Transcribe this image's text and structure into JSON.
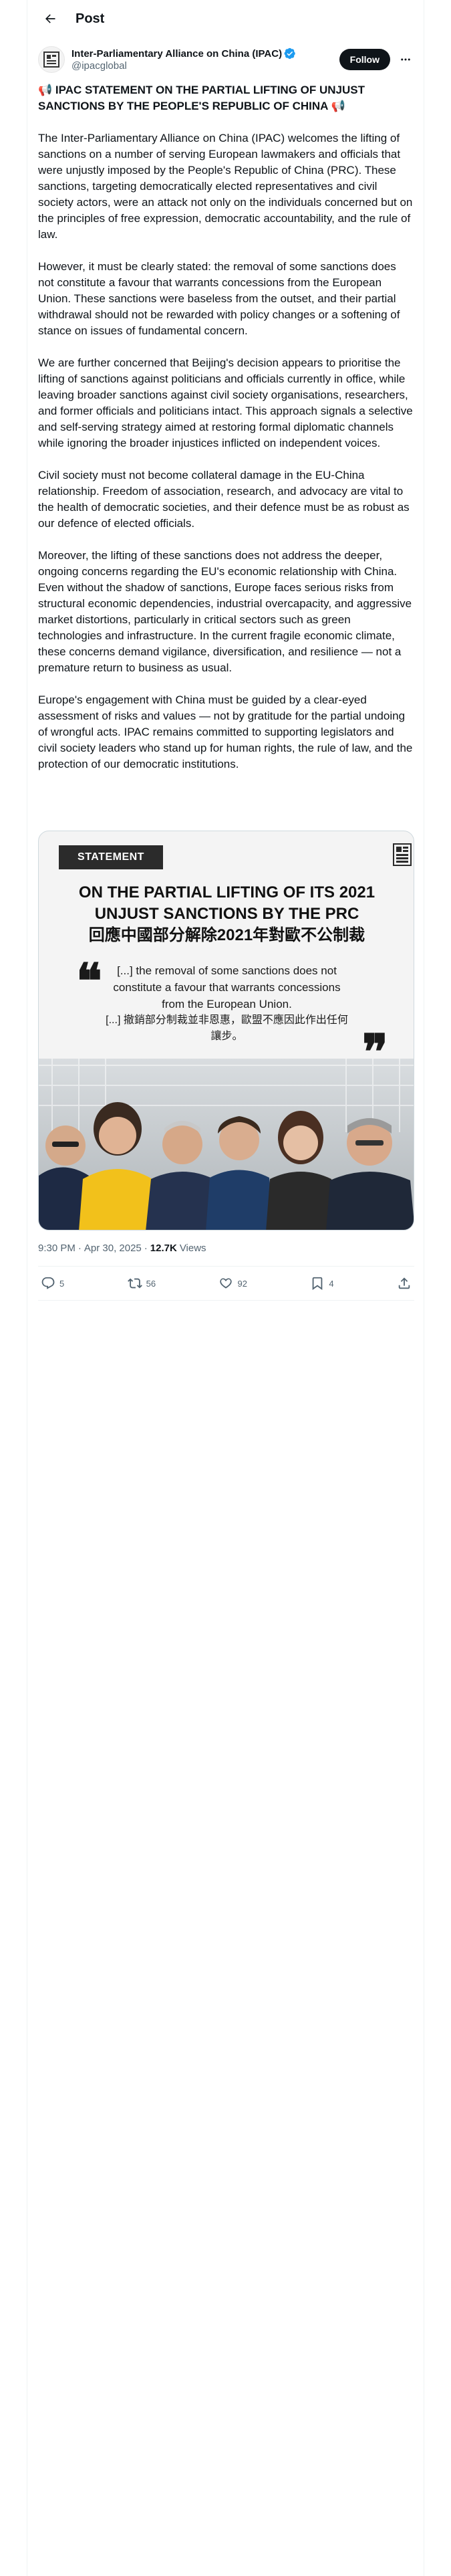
{
  "header": {
    "title": "Post",
    "back_icon": "arrow-left-icon"
  },
  "author": {
    "display_name": "Inter-Parliamentary Alliance on China (IPAC)",
    "handle": "@ipacglobal",
    "verified_icon": "verified-badge-icon",
    "verified_color": "#1d9bf0",
    "follow_label": "Follow",
    "more_icon": "more-horizontal-icon"
  },
  "post": {
    "title": "📢 IPAC STATEMENT ON THE PARTIAL LIFTING OF UNJUST SANCTIONS BY THE PEOPLE'S REPUBLIC OF CHINA 📢",
    "paragraphs": [
      "The Inter-Parliamentary Alliance on China (IPAC) welcomes the lifting of sanctions on a number of serving European lawmakers and officials that were unjustly imposed by the People's Republic of China (PRC). These sanctions, targeting democratically elected representatives and civil society actors, were an attack not only on the individuals concerned but on the principles of free expression, democratic accountability, and the rule of law.",
      "However, it must be clearly stated: the removal of some sanctions does not constitute a favour that warrants concessions from the European Union. These sanctions were baseless from the outset, and their partial withdrawal should not be rewarded with policy changes or a softening of stance on issues of fundamental concern.",
      "We are further concerned that Beijing's decision appears to prioritise the lifting of sanctions against politicians and officials currently in office, while leaving broader sanctions against civil society organisations, researchers, and former officials and politicians intact. This approach signals a selective and self-serving strategy aimed at restoring formal diplomatic channels while ignoring the broader injustices inflicted on independent voices.",
      "Civil society must not become collateral damage in the EU-China relationship. Freedom of association, research, and advocacy are vital to the health of democratic societies, and their defence must be as robust as our defence of elected officials.",
      "Moreover, the lifting of these sanctions does not address the deeper, ongoing concerns regarding the EU's economic relationship with China. Even without the shadow of sanctions, Europe faces serious risks from structural economic dependencies, industrial overcapacity, and aggressive market distortions, particularly in critical sectors such as green technologies and infrastructure. In the current fragile economic climate, these concerns demand vigilance, diversification, and resilience — not a premature return to business as usual.",
      "Europe's engagement with China must be guided by a clear-eyed assessment of risks and values — not by gratitude for the partial undoing of wrongful acts. IPAC remains committed to supporting legislators and civil society leaders who stand up for human rights, the rule of law, and the protection of our democratic institutions."
    ]
  },
  "media": {
    "tag": "STATEMENT",
    "logo_icon": "ipac-logo-icon",
    "heading_en": "ON THE PARTIAL LIFTING OF ITS 2021 UNJUST SANCTIONS BY THE PRC",
    "heading_zh": "回應中國部分解除2021年對歐不公制裁",
    "quote_en": "[...] the removal of some sanctions does not constitute a favour that warrants concessions from the European Union.",
    "quote_zh": "[...] 撤銷部分制裁並非恩惠，歐盟不應因此作出任何讓步。",
    "quote_open": "❝",
    "quote_close": "❞",
    "photo_description_icon": "group-photo-icon"
  },
  "meta": {
    "time": "9:30 PM",
    "date": "Apr 30, 2025",
    "separator": "·",
    "views_count": "12.7K",
    "views_label": "Views"
  },
  "actions": {
    "replies": "5",
    "reposts": "56",
    "likes": "92",
    "bookmarks": "4"
  },
  "colors": {
    "text": "#0f1419",
    "secondary": "#536471",
    "border": "#eff3f4",
    "follow_bg": "#0f1419"
  }
}
